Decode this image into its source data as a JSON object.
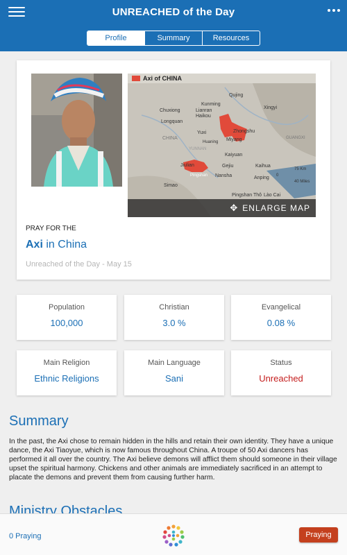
{
  "header": {
    "title": "UNREACHED of the Day",
    "tabs": [
      {
        "label": "Profile",
        "active": true
      },
      {
        "label": "Summary",
        "active": false
      },
      {
        "label": "Resources",
        "active": false
      }
    ]
  },
  "profile": {
    "map_legend": "Axi of CHINA",
    "map_places": {
      "qujing": "Qujing",
      "kunming": "Kunming",
      "xingyi": "Xingyi",
      "chuxiong": "Chuxiong",
      "lianran": "Lianran",
      "haikou": "Haikou",
      "longquan": "Longquan",
      "zhongshu": "Zhongshu",
      "yuxi": "Yuxi",
      "miyang": "Miyang",
      "huaning": "Huaning",
      "china": "CHINA",
      "yunnan": "YUNNAN",
      "guangxi": "GUANGXI",
      "kaiyuan": "Kaiyuan",
      "jiulian": "Jiulian",
      "gejiu": "Gejiu",
      "kaihua": "Kaihua",
      "nansha": "Nansha",
      "simao": "Simao",
      "anping": "Anping",
      "pingshan": "Pingshan",
      "pingshantho": "Pingshan Thô",
      "laocai": "Lào Cai",
      "scale_km": "75 Km",
      "scale_mi": "40 Miles",
      "scale_zero": "0"
    },
    "enlarge_label": "ENLARGE MAP",
    "pray_for_label": "PRAY FOR THE",
    "people_name": "Axi",
    "people_country": "in China",
    "date_label": "Unreached of the Day - May 15"
  },
  "stats": {
    "population": {
      "label": "Population",
      "value": "100,000"
    },
    "christian": {
      "label": "Christian",
      "value": "3.0 %"
    },
    "evangelical": {
      "label": "Evangelical",
      "value": "0.08 %"
    },
    "religion": {
      "label": "Main Religion",
      "value": "Ethnic Religions"
    },
    "language": {
      "label": "Main Language",
      "value": "Sani"
    },
    "status": {
      "label": "Status",
      "value": "Unreached"
    }
  },
  "summary": {
    "title": "Summary",
    "text": "In the past, the Axi chose to remain hidden in the hills and retain their own identity. They have a unique dance, the Axi Tiaoyue, which is now famous throughout China. A troupe of 50 Axi dancers has performed it all over the country. The Axi believe demons will afflict them should someone in their village upset the spiritual harmony. Chickens and other animals are immediately sacrificed in an attempt to placate the demons and prevent them from causing further harm."
  },
  "ministry": {
    "title": "Ministry Obstacles"
  },
  "footer": {
    "praying_count": "0 Praying",
    "pray_button": "Praying"
  },
  "colors": {
    "brand": "#1b6fb5",
    "status_red": "#c41d1d",
    "button": "#c4401e",
    "map_highlight": "#e14a3a"
  },
  "icons": {
    "menu": "menu-icon",
    "more": "more-vertical-icon",
    "expand": "expand-icon",
    "logo": "logo-icon"
  }
}
